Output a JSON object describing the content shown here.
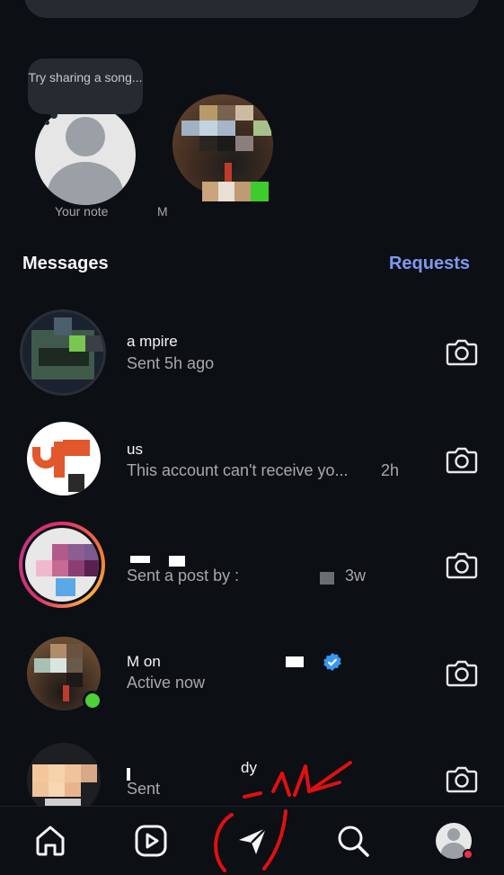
{
  "notes": {
    "own_bubble": "Try sharing a song...",
    "own_label": "Your note",
    "friend_label": "M"
  },
  "messages_header": {
    "title": "Messages",
    "requests": "Requests"
  },
  "conversations": [
    {
      "name": "a          mpire",
      "subtitle": "Sent 5h ago",
      "time": ""
    },
    {
      "name": "us",
      "subtitle": "This account can't receive yo...",
      "time": "2h"
    },
    {
      "name": "",
      "subtitle": "Sent a post by :",
      "time": "3w"
    },
    {
      "name": "M            on",
      "subtitle": "Active now",
      "time": "",
      "verified": true
    },
    {
      "name": "dy",
      "subtitle": "Sent",
      "time": ""
    }
  ],
  "bottom_nav": [
    "home-icon",
    "reels-icon",
    "direct-icon",
    "search-icon",
    "profile-icon"
  ],
  "colors": {
    "background": "#0c0f14",
    "accent": "#7f98f2",
    "online": "#4cd137",
    "verified": "#3897f0",
    "annotation": "#e01010"
  }
}
